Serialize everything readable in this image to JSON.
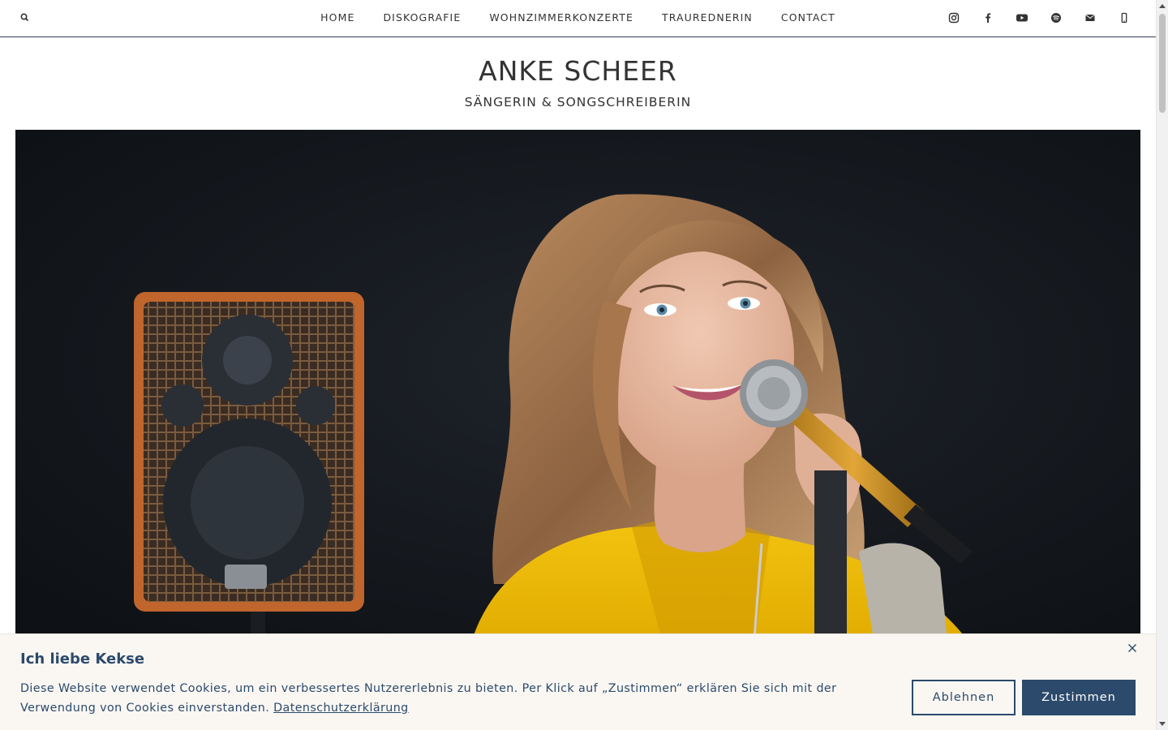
{
  "nav": {
    "items": [
      {
        "label": "HOME"
      },
      {
        "label": "DISKOGRAFIE"
      },
      {
        "label": "WOHNZIMMERKONZERTE"
      },
      {
        "label": "TRAUREDNERIN"
      },
      {
        "label": "CONTACT"
      }
    ],
    "social_icons": [
      "instagram-icon",
      "facebook-icon",
      "youtube-icon",
      "spotify-icon",
      "mail-icon",
      "phone-icon"
    ]
  },
  "header": {
    "title": "ANKE SCHEER",
    "subtitle": "SÄNGERIN & SONGSCHREIBERIN"
  },
  "cookie": {
    "title": "Ich liebe Kekse ",
    "text": "Diese Website verwendet Cookies, um ein verbessertes Nutzererlebnis zu bieten. Per Klick auf „Zustimmen“ erklären Sie sich mit der Verwendung von Cookies einverstanden.",
    "link": "Datenschutzerklärung",
    "decline": "Ablehnen",
    "accept": "Zustimmen"
  },
  "colors": {
    "accent": "#2c4a6b",
    "banner_bg": "#faf7f3"
  }
}
